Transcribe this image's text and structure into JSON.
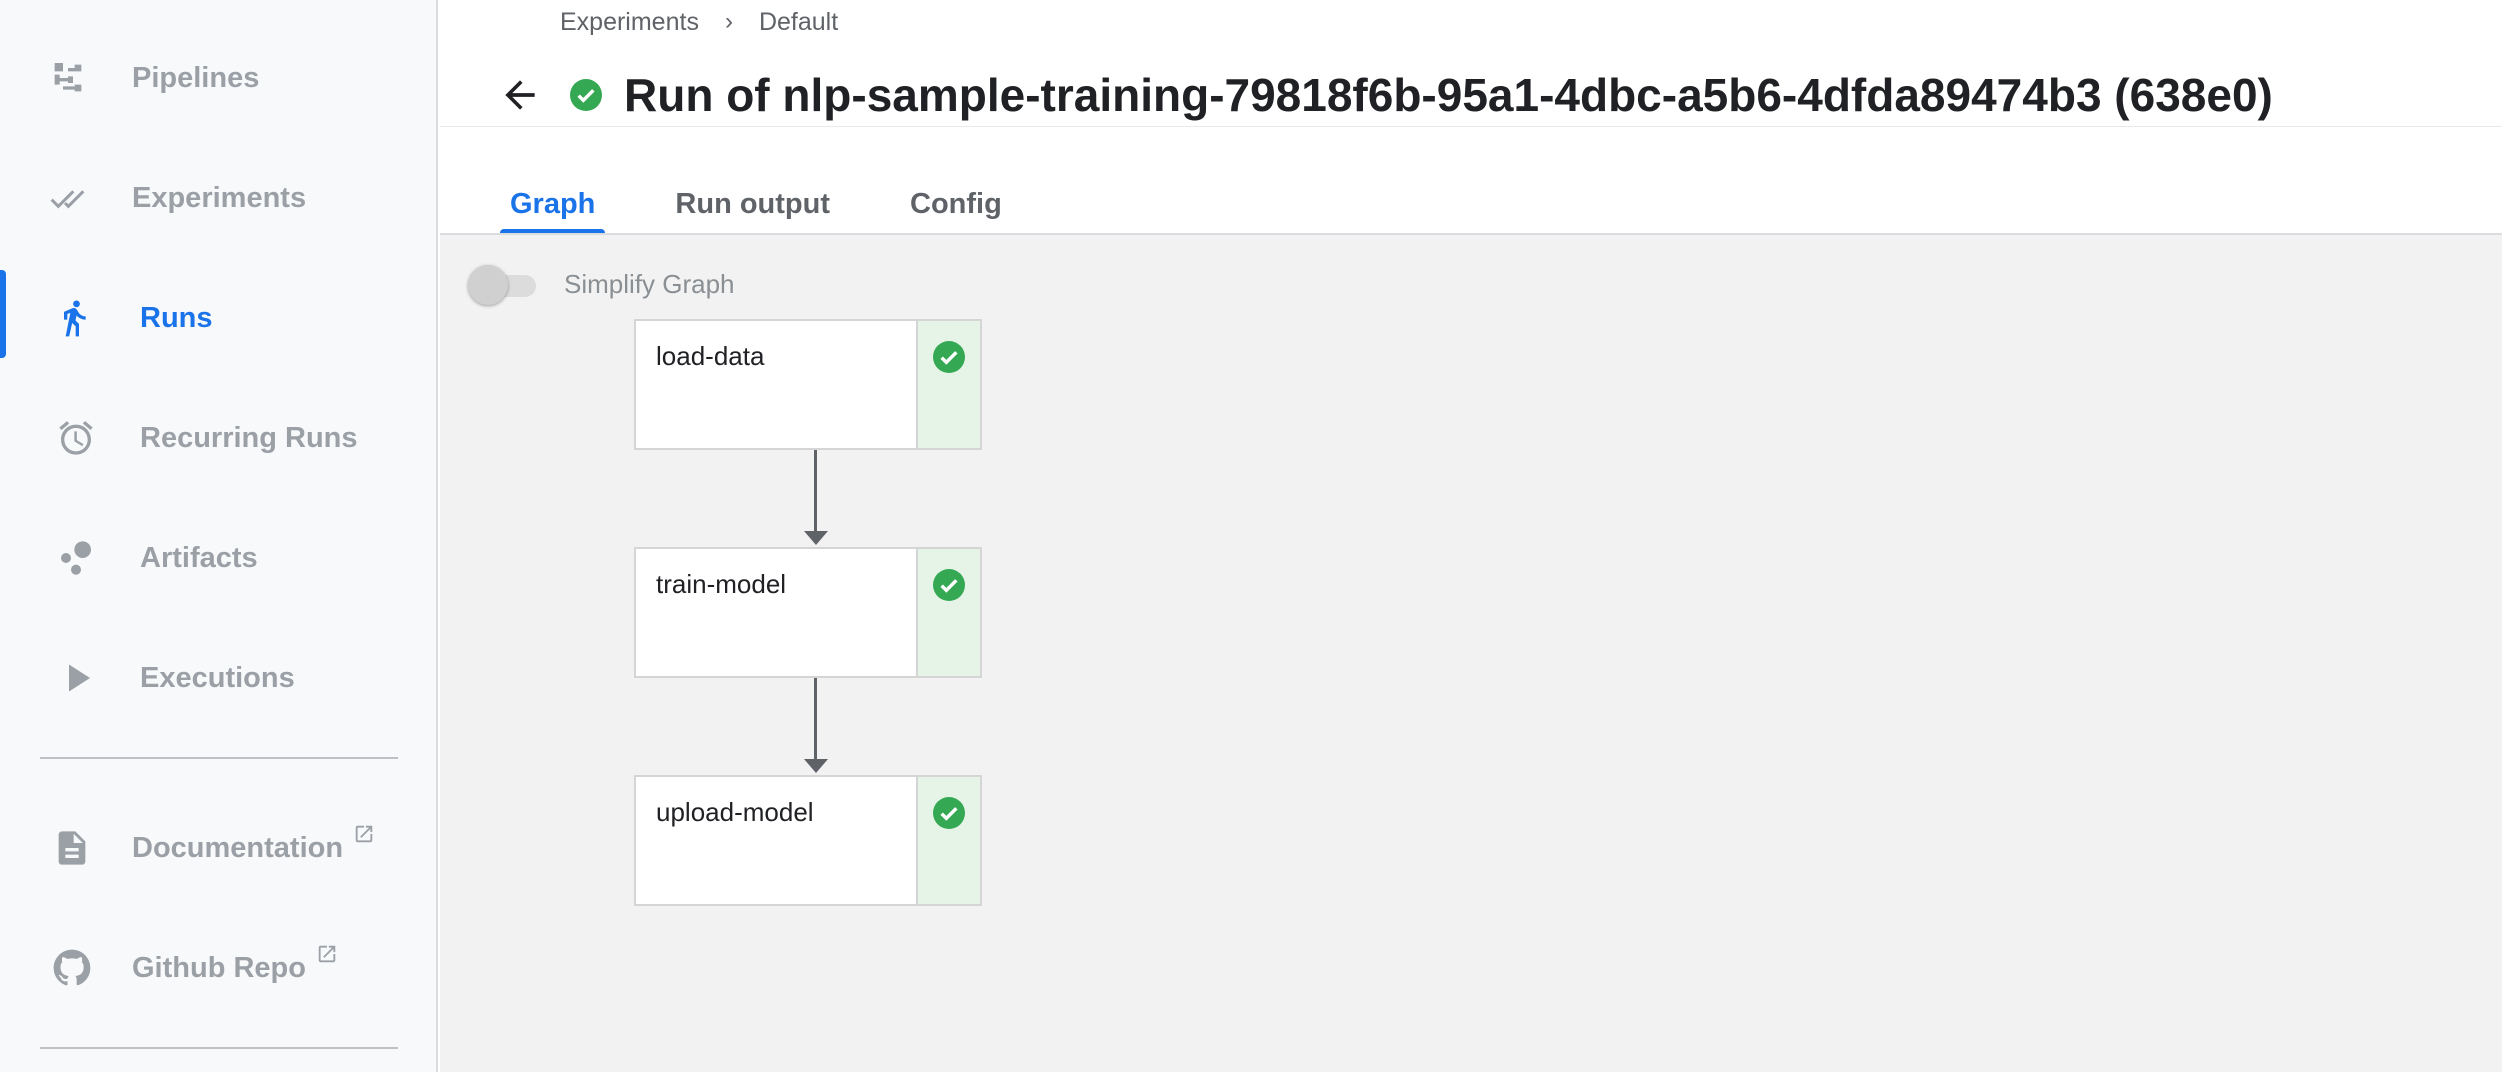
{
  "sidebar": {
    "items": [
      {
        "label": "Pipelines",
        "icon": "pipelines-icon"
      },
      {
        "label": "Experiments",
        "icon": "experiments-icon"
      },
      {
        "label": "Runs",
        "icon": "runs-icon",
        "active": true
      },
      {
        "label": "Recurring Runs",
        "icon": "alarm-clock-icon"
      },
      {
        "label": "Artifacts",
        "icon": "artifacts-icon"
      },
      {
        "label": "Executions",
        "icon": "play-icon"
      }
    ],
    "links": [
      {
        "label": "Documentation",
        "icon": "document-icon"
      },
      {
        "label": "Github Repo",
        "icon": "github-icon"
      }
    ]
  },
  "header": {
    "breadcrumbs": [
      "Experiments",
      "Default"
    ],
    "title": "Run of nlp-sample-training-79818f6b-95a1-4dbc-a5b6-4dfda89474b3 (638e0)",
    "status": "succeeded"
  },
  "tabs": [
    {
      "label": "Graph",
      "active": true
    },
    {
      "label": "Run output"
    },
    {
      "label": "Config"
    }
  ],
  "graph": {
    "simplify_label": "Simplify Graph",
    "simplify_enabled": false,
    "nodes": [
      {
        "name": "load-data",
        "status": "succeeded"
      },
      {
        "name": "train-model",
        "status": "succeeded"
      },
      {
        "name": "upload-model",
        "status": "succeeded"
      }
    ]
  },
  "colors": {
    "accent": "#1a73e8",
    "success": "#34a853",
    "success_bg": "#e6f4e8"
  }
}
